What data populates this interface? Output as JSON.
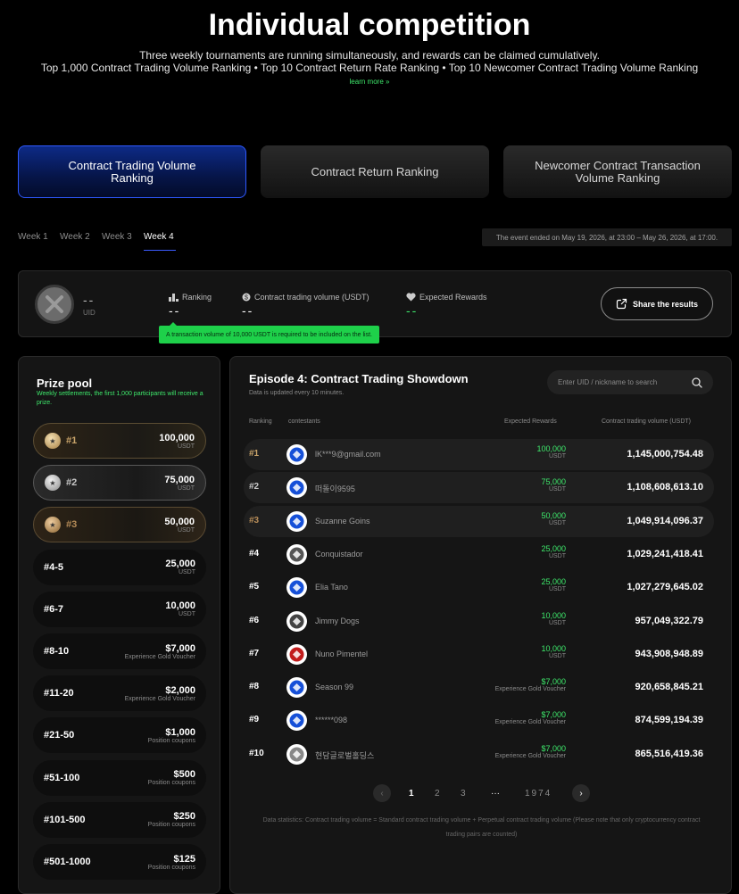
{
  "hero": {
    "title": "Individual competition",
    "subtitle1": "Three weekly tournaments are running simultaneously, and rewards can be claimed cumulatively.",
    "subtitle2": "Top 1,000 Contract Trading Volume Ranking • Top 10 Contract Return Rate Ranking • Top 10 Newcomer Contract Trading Volume Ranking",
    "learn_more": "learn more »"
  },
  "tabs": [
    {
      "label": "Contract Trading Volume Ranking"
    },
    {
      "label": "Contract Return Ranking"
    },
    {
      "label": "Newcomer Contract Transaction Volume Ranking"
    }
  ],
  "weeks": [
    "Week 1",
    "Week 2",
    "Week 3",
    "Week 4"
  ],
  "event_note": "The event ended on May 19, 2026, at 23:00 – May 26, 2026, at 17:00.",
  "user_card": {
    "uid_value": "--",
    "uid_label": "UID",
    "ranking_label": "Ranking",
    "ranking_value": "--",
    "volume_label": "Contract trading volume (USDT)",
    "volume_value": "--",
    "rewards_label": "Expected Rewards",
    "rewards_value": "--",
    "share_label": "Share the results",
    "tooltip": "A transaction volume of 10,000 USDT is required to be included on the list."
  },
  "prize_pool": {
    "title": "Prize pool",
    "note": "Weekly settlements, the first 1,000 participants will receive a prize.",
    "rows": [
      {
        "rank": "#1",
        "amount": "100,000",
        "unit": "USDT"
      },
      {
        "rank": "#2",
        "amount": "75,000",
        "unit": "USDT"
      },
      {
        "rank": "#3",
        "amount": "50,000",
        "unit": "USDT"
      },
      {
        "rank": "#4-5",
        "amount": "25,000",
        "unit": "USDT"
      },
      {
        "rank": "#6-7",
        "amount": "10,000",
        "unit": "USDT"
      },
      {
        "rank": "#8-10",
        "amount": "$7,000",
        "unit": "Experience Gold Voucher"
      },
      {
        "rank": "#11-20",
        "amount": "$2,000",
        "unit": "Experience Gold Voucher"
      },
      {
        "rank": "#21-50",
        "amount": "$1,000",
        "unit": "Position coupons"
      },
      {
        "rank": "#51-100",
        "amount": "$500",
        "unit": "Position coupons"
      },
      {
        "rank": "#101-500",
        "amount": "$250",
        "unit": "Position coupons"
      },
      {
        "rank": "#501-1000",
        "amount": "$125",
        "unit": "Position coupons"
      }
    ]
  },
  "leaderboard": {
    "title": "Episode 4: Contract Trading Showdown",
    "updated": "Data is updated every 10 minutes.",
    "search_placeholder": "Enter UID / nickname to search",
    "headers": {
      "ranking": "Ranking",
      "contestants": "contestants",
      "rewards": "Expected Rewards",
      "volume": "Contract trading volume (USDT)"
    },
    "rows": [
      {
        "rank": "#1",
        "name": "lK***9@gmail.com",
        "reward": "100,000",
        "unit": "USDT",
        "volume": "1,145,000,754.48"
      },
      {
        "rank": "#2",
        "name": "떠돌이9595",
        "reward": "75,000",
        "unit": "USDT",
        "volume": "1,108,608,613.10"
      },
      {
        "rank": "#3",
        "name": "Suzanne Goins",
        "reward": "50,000",
        "unit": "USDT",
        "volume": "1,049,914,096.37"
      },
      {
        "rank": "#4",
        "name": "Conquistador",
        "reward": "25,000",
        "unit": "USDT",
        "volume": "1,029,241,418.41"
      },
      {
        "rank": "#5",
        "name": "Elia Tano",
        "reward": "25,000",
        "unit": "USDT",
        "volume": "1,027,279,645.02"
      },
      {
        "rank": "#6",
        "name": "Jimmy Dogs",
        "reward": "10,000",
        "unit": "USDT",
        "volume": "957,049,322.79"
      },
      {
        "rank": "#7",
        "name": "Nuno Pimentel",
        "reward": "10,000",
        "unit": "USDT",
        "volume": "943,908,948.89"
      },
      {
        "rank": "#8",
        "name": "Season 99",
        "reward": "$7,000",
        "unit": "Experience Gold Voucher",
        "volume": "920,658,845.21"
      },
      {
        "rank": "#9",
        "name": "******098",
        "reward": "$7,000",
        "unit": "Experience Gold Voucher",
        "volume": "874,599,194.39"
      },
      {
        "rank": "#10",
        "name": "현담글로벌홀딩스",
        "reward": "$7,000",
        "unit": "Experience Gold Voucher",
        "volume": "865,516,419.36"
      }
    ],
    "pagination": {
      "pages": [
        "1",
        "2",
        "3",
        "···",
        "1974"
      ],
      "prev": "‹",
      "next": "›"
    },
    "footnote": "Data statistics: Contract trading volume = Standard contract trading volume + Perpetual contract trading volume (Please note that only cryptocurrency contract trading pairs are counted)"
  },
  "colors": {
    "accent_green": "#3ee86b",
    "accent_blue": "#2f59ff",
    "gold": "#c9a46a"
  }
}
